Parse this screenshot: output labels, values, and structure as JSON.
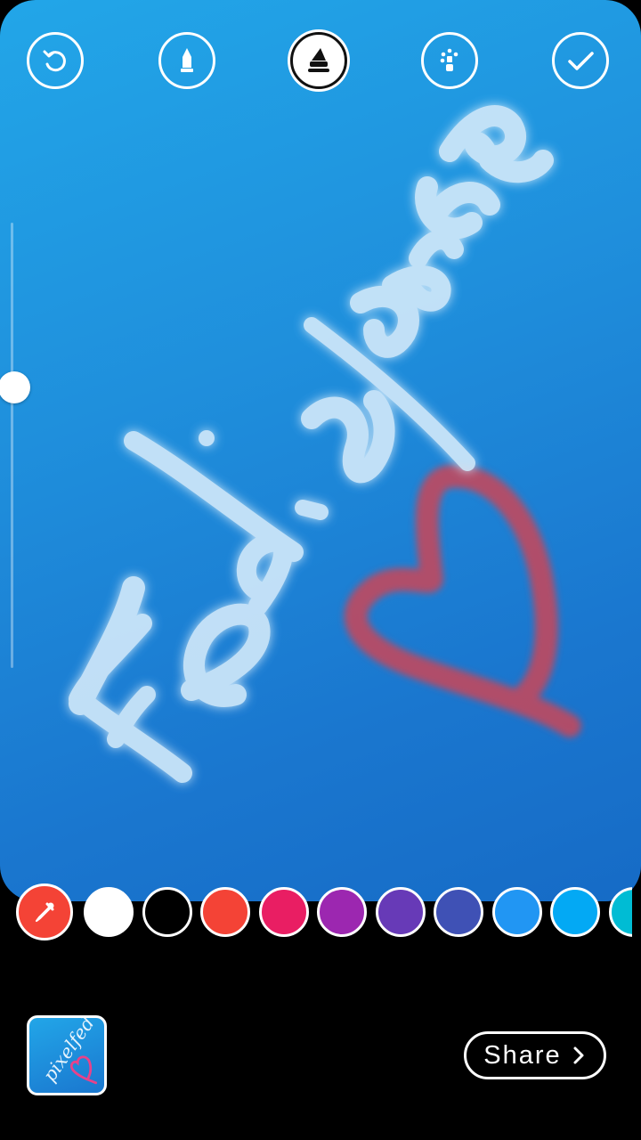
{
  "toolbar": {
    "tools": [
      {
        "name": "undo",
        "icon": "undo-icon"
      },
      {
        "name": "marker",
        "icon": "marker-icon"
      },
      {
        "name": "neon-brush",
        "icon": "neon-brush-icon",
        "active": true
      },
      {
        "name": "eraser",
        "icon": "eraser-icon"
      },
      {
        "name": "done",
        "icon": "checkmark-icon"
      }
    ]
  },
  "canvas": {
    "drawing_text": "FediSpace",
    "drawing_color": "#ffffff",
    "heart_color": "#c0485e",
    "background_color": "#1f8fdc"
  },
  "brush_size": {
    "level": 0.63
  },
  "palette": {
    "picker_icon": "eyedropper-icon",
    "picker_color": "#f44336",
    "colors": [
      "#ffffff",
      "#000000",
      "#f44336",
      "#e91e63",
      "#9c27b0",
      "#673ab7",
      "#3f51b5",
      "#2196f3",
      "#03a9f4",
      "#00bcd4"
    ]
  },
  "bottom": {
    "thumbnail_text": "pixelfed",
    "share_label": "Share",
    "share_icon": "chevron-right-icon"
  }
}
